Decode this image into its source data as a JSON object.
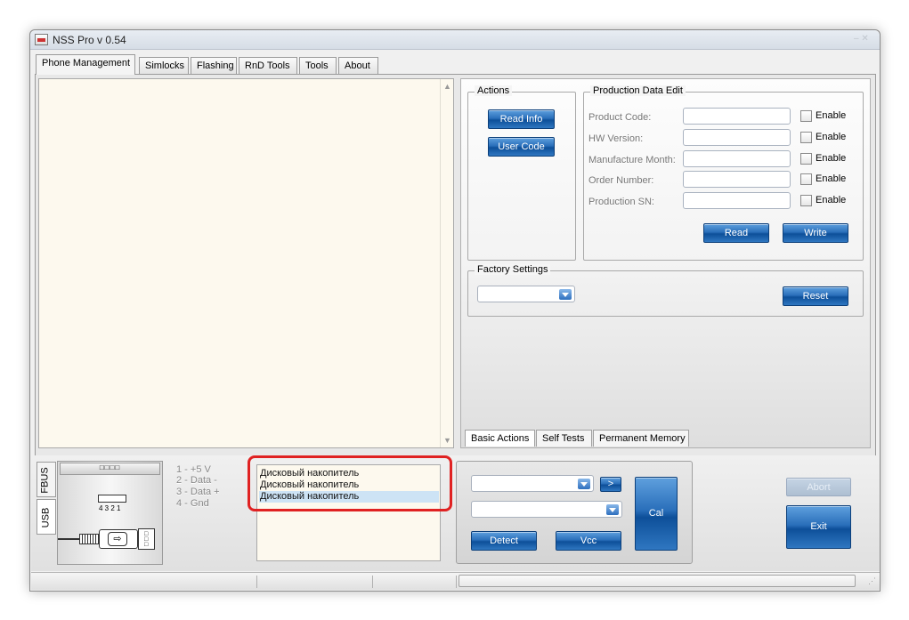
{
  "window": {
    "title": "NSS Pro v 0.54"
  },
  "main_tabs": [
    "Phone Management",
    "Simlocks",
    "Flashing",
    "RnD Tools",
    "Tools",
    "About"
  ],
  "actions": {
    "label": "Actions",
    "read_info": "Read Info",
    "user_code": "User Code"
  },
  "production": {
    "label": "Production Data Edit",
    "fields": [
      {
        "label": "Product Code:",
        "value": "",
        "enable": "Enable"
      },
      {
        "label": "HW Version:",
        "value": "",
        "enable": "Enable"
      },
      {
        "label": "Manufacture Month:",
        "value": "",
        "enable": "Enable"
      },
      {
        "label": "Order Number:",
        "value": "",
        "enable": "Enable"
      },
      {
        "label": "Production SN:",
        "value": "",
        "enable": "Enable"
      }
    ],
    "read": "Read",
    "write": "Write"
  },
  "factory": {
    "label": "Factory Settings",
    "selected": "",
    "reset": "Reset"
  },
  "sub_tabs": [
    "Basic Actions",
    "Self Tests",
    "Permanent Memory"
  ],
  "side_tabs": [
    "FBUS",
    "USB"
  ],
  "usb": {
    "pin_numbers": "4 3 2 1",
    "pins": [
      "1 - +5 V",
      "2 - Data -",
      "3 - Data +",
      "4 - Gnd"
    ]
  },
  "devices": [
    "Дисковый накопитель",
    "Дисковый накопитель",
    "Дисковый накопитель"
  ],
  "controls": {
    "port_combo": "",
    "second_combo": "",
    "go": ">",
    "cal": "Cal",
    "detect": "Detect",
    "vcc": "Vcc"
  },
  "buttons": {
    "abort": "Abort",
    "exit": "Exit"
  },
  "colors": {
    "accent": "#1f5fa8",
    "log_bg": "#fdf9ee",
    "highlight": "#e02222"
  }
}
